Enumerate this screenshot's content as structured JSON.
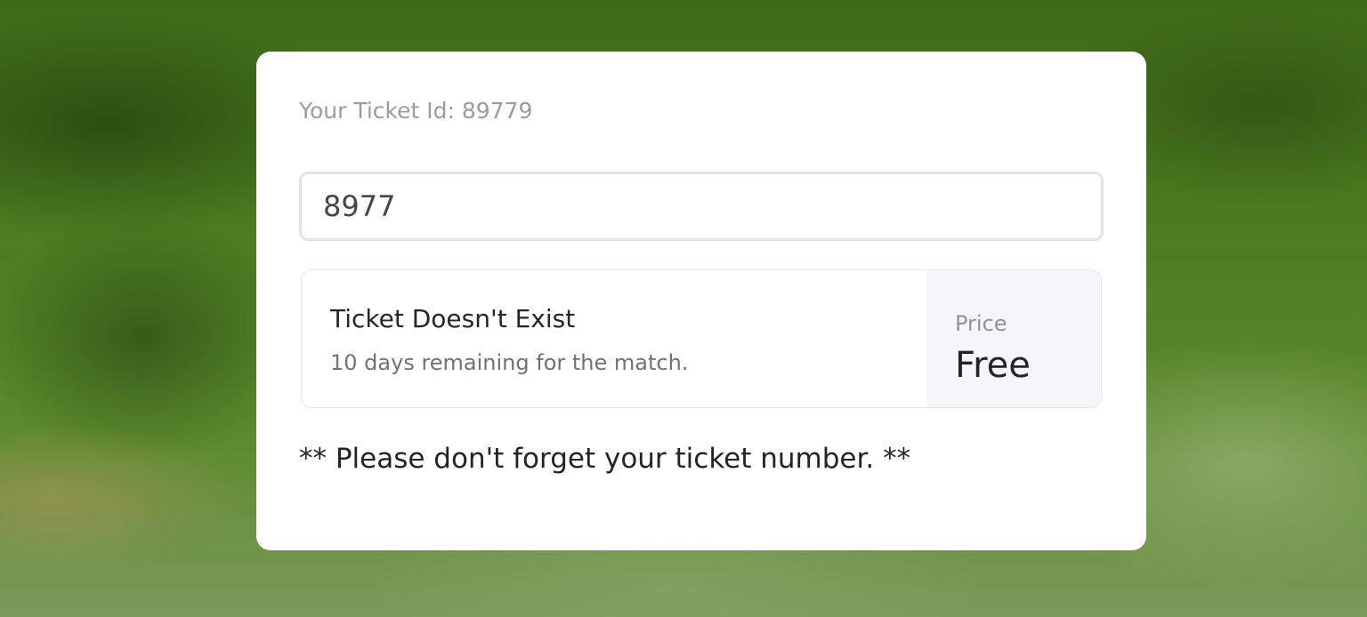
{
  "ticket": {
    "id_label": "Your Ticket Id: 89779",
    "input_value": "8977"
  },
  "result": {
    "title": "Ticket Doesn't Exist",
    "subtitle": "10 days remaining for the match.",
    "price_label": "Price",
    "price_value": "Free"
  },
  "note": {
    "text": "** Please don't forget your ticket number. **"
  },
  "colors": {
    "card_background": "#ffffff",
    "price_panel_background": "#f4f6fa",
    "muted_text": "#9a9ca2"
  }
}
